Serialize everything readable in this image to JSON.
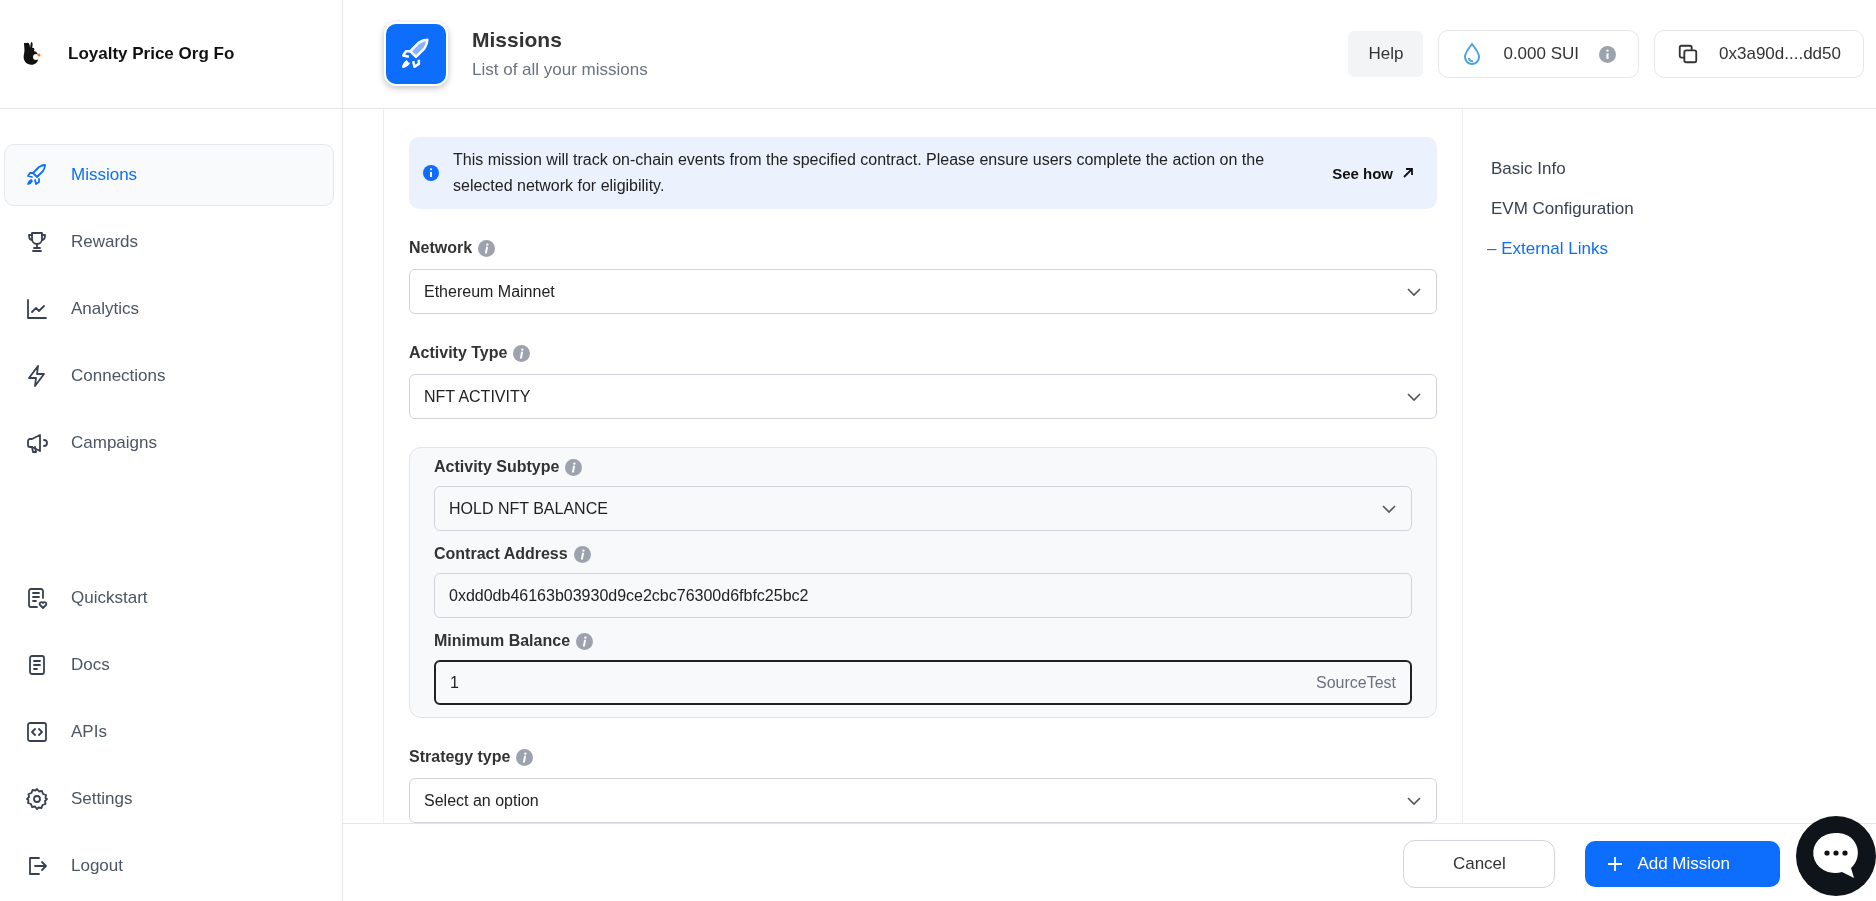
{
  "sidebar": {
    "org_name": "Loyalty Price Org Fo",
    "nav": [
      {
        "label": "Missions",
        "selected": true
      },
      {
        "label": "Rewards",
        "selected": false
      },
      {
        "label": "Analytics",
        "selected": false
      },
      {
        "label": "Connections",
        "selected": false
      },
      {
        "label": "Campaigns",
        "selected": false
      }
    ],
    "bottom_nav": [
      {
        "label": "Quickstart"
      },
      {
        "label": "Docs"
      },
      {
        "label": "APIs"
      },
      {
        "label": "Settings"
      },
      {
        "label": "Logout"
      }
    ]
  },
  "header": {
    "title": "Missions",
    "subtitle": "List of all your missions",
    "help": "Help",
    "balance": "0.000 SUI",
    "wallet": "0x3a90d....dd50"
  },
  "banner": {
    "text": "This mission will track on-chain events from the specified contract. Please ensure users complete the action on the selected network for eligibility.",
    "link": "See how"
  },
  "fields": [
    {
      "kind": "select",
      "label": "Network",
      "value": "Ethereum Mainnet"
    },
    {
      "kind": "select",
      "label": "Activity Type",
      "value": "NFT ACTIVITY"
    },
    {
      "kind": "group",
      "fields": [
        {
          "kind": "select",
          "label": "Activity Subtype",
          "value": "HOLD NFT BALANCE"
        },
        {
          "kind": "input",
          "label": "Contract Address",
          "value": "0xdd0db46163b03930d9ce2cbc76300d6fbfc25bc2",
          "focused": false
        },
        {
          "kind": "input",
          "label": "Minimum Balance",
          "value": "1",
          "suffix": "SourceTest",
          "focused": true
        }
      ]
    },
    {
      "kind": "select",
      "label": "Strategy type",
      "placeholder": "Select an option"
    }
  ],
  "toc": [
    {
      "label": "Basic Info",
      "selected": false
    },
    {
      "label": "EVM Configuration",
      "selected": false
    },
    {
      "label": "– External Links",
      "selected": true
    }
  ],
  "footer": {
    "cancel": "Cancel",
    "add": "Add Mission"
  }
}
